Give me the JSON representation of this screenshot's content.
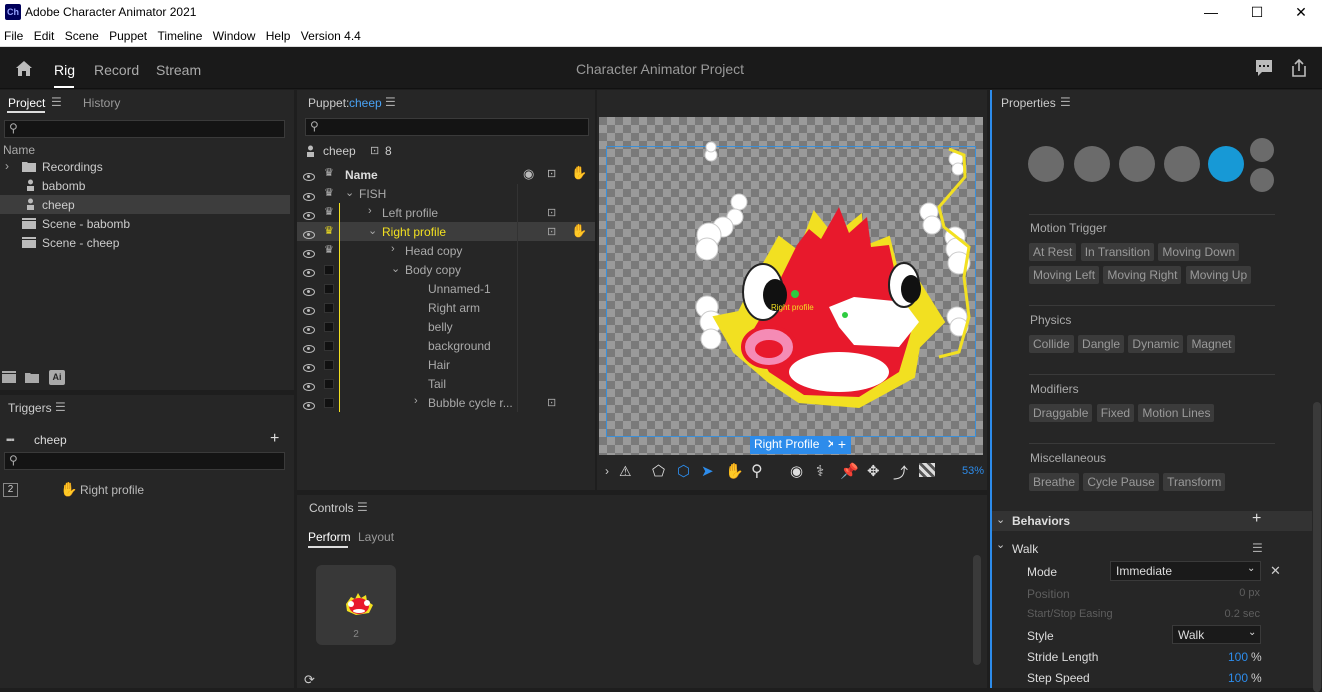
{
  "window": {
    "app_icon": "Ch",
    "title": "Adobe Character Animator 2021",
    "minimize": "—",
    "maximize": "☐",
    "close": "✕"
  },
  "menu": [
    "File",
    "Edit",
    "Scene",
    "Puppet",
    "Timeline",
    "Window",
    "Help",
    "Version 4.4"
  ],
  "topbar": {
    "tabs": [
      "Rig",
      "Record",
      "Stream"
    ],
    "active_tab": "Rig",
    "project_title": "Character Animator Project"
  },
  "project_panel": {
    "tabs": [
      "Project",
      "History"
    ],
    "column": "Name",
    "items": [
      {
        "label": "Recordings",
        "icon": "folder-icon",
        "expandable": true
      },
      {
        "label": "babomb",
        "icon": "puppet-icon"
      },
      {
        "label": "cheep",
        "icon": "puppet-icon",
        "selected": true
      },
      {
        "label": "Scene - babomb",
        "icon": "scene-icon"
      },
      {
        "label": "Scene - cheep",
        "icon": "scene-icon"
      }
    ],
    "ai_badge": "Ai"
  },
  "triggers_panel": {
    "title": "Triggers",
    "puppet": "cheep",
    "trigger_key": "2",
    "trigger_label": "Right profile"
  },
  "puppet_panel": {
    "title_prefix": "Puppet:",
    "puppet_name": "cheep",
    "count": "8",
    "column": "Name",
    "rows": [
      {
        "label": "FISH",
        "indent": 0,
        "chevron": "v",
        "yellow": false
      },
      {
        "label": "Left profile",
        "indent": 1,
        "chevron": ">",
        "yellow": false,
        "tag": true
      },
      {
        "label": "Right profile",
        "indent": 1,
        "chevron": "v",
        "yellow": true,
        "tag": true,
        "hand": true,
        "selected": true
      },
      {
        "label": "Head copy",
        "indent": 2,
        "chevron": ">",
        "yellow": false
      },
      {
        "label": "Body copy",
        "indent": 2,
        "chevron": "v",
        "yellow": false
      },
      {
        "label": "Unnamed-1",
        "indent": 3,
        "chevron": "",
        "yellow": false
      },
      {
        "label": "Right arm",
        "indent": 3,
        "chevron": "",
        "yellow": false
      },
      {
        "label": "belly",
        "indent": 3,
        "chevron": "",
        "yellow": false
      },
      {
        "label": "background",
        "indent": 3,
        "chevron": "",
        "yellow": false
      },
      {
        "label": "Hair",
        "indent": 3,
        "chevron": "",
        "yellow": false
      },
      {
        "label": "Tail",
        "indent": 3,
        "chevron": "",
        "yellow": false
      },
      {
        "label": "Bubble cycle r...",
        "indent": 3,
        "chevron": ">",
        "yellow": false,
        "tag": true
      }
    ]
  },
  "canvas": {
    "handle_label": "Right profile",
    "chip_label": "Right Profile",
    "zoom": "53%"
  },
  "controls_panel": {
    "title": "Controls",
    "tabs": [
      "Perform",
      "Layout"
    ],
    "active_tab": "Perform",
    "thumb_label": "2"
  },
  "properties_panel": {
    "title": "Properties",
    "sections": [
      {
        "title": "Motion Trigger",
        "tags": [
          "At Rest",
          "In Transition",
          "Moving Down",
          "Moving Left",
          "Moving Right",
          "Moving Up"
        ]
      },
      {
        "title": "Physics",
        "tags": [
          "Collide",
          "Dangle",
          "Dynamic",
          "Magnet"
        ]
      },
      {
        "title": "Modifiers",
        "tags": [
          "Draggable",
          "Fixed",
          "Motion Lines"
        ]
      },
      {
        "title": "Miscellaneous",
        "tags": [
          "Breathe",
          "Cycle Pause",
          "Transform"
        ]
      }
    ],
    "behaviors_label": "Behaviors",
    "walk": {
      "title": "Walk",
      "mode_label": "Mode",
      "mode_value": "Immediate",
      "position_label": "Position",
      "position_value": "0 px",
      "easing_label": "Start/Stop Easing",
      "easing_value": "0.2 sec",
      "style_label": "Style",
      "style_value": "Walk",
      "stride_label": "Stride Length",
      "stride_value": "100",
      "stride_unit": "%",
      "step_label": "Step Speed",
      "step_value": "100",
      "step_unit": "%"
    }
  },
  "colors": {
    "accent": "#2d8ceb",
    "yellow": "#f2e021",
    "fish_red": "#e8192c",
    "bg": "#1e1e1e",
    "panel": "#262626"
  }
}
